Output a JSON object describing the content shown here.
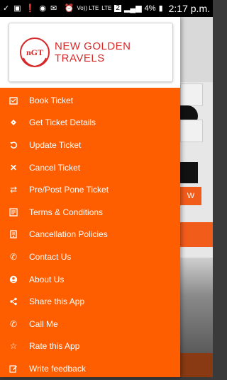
{
  "status_bar": {
    "time": "2:17 p.m.",
    "battery": "4%",
    "network_1": "Vo)) LTE",
    "network_2": "LTE",
    "sim_badge": "2",
    "icons": [
      "check-icon",
      "image-icon",
      "alert-icon",
      "whatsapp-icon",
      "mail-icon",
      "alarm-icon",
      "signal-icon",
      "battery-icon"
    ]
  },
  "logo": {
    "emblem_text": "nGT",
    "name": "NEW GOLDEN TRAVELS"
  },
  "background": {
    "button_text": "W"
  },
  "menu": {
    "items": [
      {
        "label": "Book Ticket",
        "icon": "calendar-check-icon"
      },
      {
        "label": "Get Ticket Details",
        "icon": "ticket-icon"
      },
      {
        "label": "Update Ticket",
        "icon": "undo-icon"
      },
      {
        "label": "Cancel Ticket",
        "icon": "close-icon"
      },
      {
        "label": "Pre/Post Pone Ticket",
        "icon": "swap-icon"
      },
      {
        "label": "Terms & Conditions",
        "icon": "document-list-icon"
      },
      {
        "label": "Cancellation Policies",
        "icon": "policy-document-icon"
      },
      {
        "label": "Contact Us",
        "icon": "phone-icon"
      },
      {
        "label": "About Us",
        "icon": "user-circle-icon"
      },
      {
        "label": "Share this App",
        "icon": "share-icon"
      },
      {
        "label": "Call Me",
        "icon": "phone-icon"
      },
      {
        "label": "Rate this App",
        "icon": "star-icon"
      },
      {
        "label": "Write feedback",
        "icon": "edit-icon"
      }
    ]
  },
  "colors": {
    "drawer": "#fe5d00",
    "brand_text": "#d62828"
  }
}
